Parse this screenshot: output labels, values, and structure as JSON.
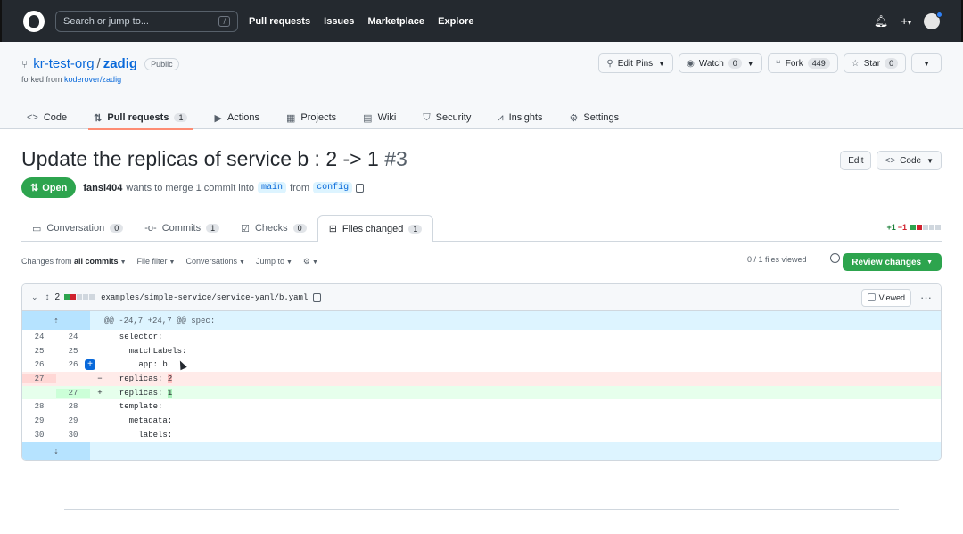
{
  "header": {
    "search_placeholder": "Search or jump to...",
    "search_shortcut": "/",
    "nav": [
      "Pull requests",
      "Issues",
      "Marketplace",
      "Explore"
    ],
    "bell_icon": "bell-icon",
    "plus_icon": "plus-icon",
    "plus_caret": "▾"
  },
  "repo": {
    "owner": "kr-test-org",
    "separator": "/",
    "name": "zadig",
    "visibility": "Public",
    "forked_prefix": "forked from",
    "forked_from": "koderover/zadig",
    "edit_pins": "Edit Pins",
    "watch": "Watch",
    "watch_count": "0",
    "fork": "Fork",
    "fork_count": "449",
    "star": "Star",
    "star_count": "0",
    "tabs": [
      {
        "label": "Code",
        "icon": "<>"
      },
      {
        "label": "Pull requests",
        "icon": "⇅",
        "count": "1"
      },
      {
        "label": "Actions",
        "icon": "▶"
      },
      {
        "label": "Projects",
        "icon": "▦"
      },
      {
        "label": "Wiki",
        "icon": "▤"
      },
      {
        "label": "Security",
        "icon": "⛉"
      },
      {
        "label": "Insights",
        "icon": "⩘"
      },
      {
        "label": "Settings",
        "icon": "⚙"
      }
    ]
  },
  "pr": {
    "title": "Update the replicas of service b : 2 -> 1",
    "number": "#3",
    "edit_label": "Edit",
    "code_label": "Code",
    "status": "Open",
    "author": "fansi404",
    "meta_text": "wants to merge 1 commit into",
    "base_branch": "main",
    "from_text": "from",
    "head_branch": "config",
    "tabs": [
      {
        "label": "Conversation",
        "count": "0",
        "icon": "💬"
      },
      {
        "label": "Commits",
        "count": "1",
        "icon": "-o-"
      },
      {
        "label": "Checks",
        "count": "0",
        "icon": "☑"
      },
      {
        "label": "Files changed",
        "count": "1",
        "icon": "⊞"
      }
    ],
    "diffstat_add": "+1",
    "diffstat_del": "−1"
  },
  "toolbar": {
    "changes_from_prefix": "Changes from",
    "changes_from_value": "all commits",
    "file_filter": "File filter",
    "conversations": "Conversations",
    "jump_to": "Jump to",
    "files_viewed": "0 / 1 files viewed",
    "review_changes": "Review changes"
  },
  "file": {
    "changes_count": "2",
    "path": "examples/simple-service/service-yaml/b.yaml",
    "viewed_label": "Viewed",
    "hunk_header": "@@ -24,7 +24,7 @@ spec:",
    "lines": [
      {
        "old": "24",
        "new": "24",
        "sign": "",
        "code": "  selector:",
        "type": "ctx"
      },
      {
        "old": "25",
        "new": "25",
        "sign": "",
        "code": "    matchLabels:",
        "type": "ctx"
      },
      {
        "old": "26",
        "new": "26",
        "sign": "",
        "code": "      app: b",
        "type": "ctx"
      },
      {
        "old": "27",
        "new": "",
        "sign": "−",
        "code": "  replicas: ",
        "hl": "2",
        "type": "del"
      },
      {
        "old": "",
        "new": "27",
        "sign": "+",
        "code": "  replicas: ",
        "hl": "1",
        "type": "add"
      },
      {
        "old": "28",
        "new": "28",
        "sign": "",
        "code": "  template:",
        "type": "ctx"
      },
      {
        "old": "29",
        "new": "29",
        "sign": "",
        "code": "    metadata:",
        "type": "ctx"
      },
      {
        "old": "30",
        "new": "30",
        "sign": "",
        "code": "      labels:",
        "type": "ctx"
      }
    ]
  }
}
